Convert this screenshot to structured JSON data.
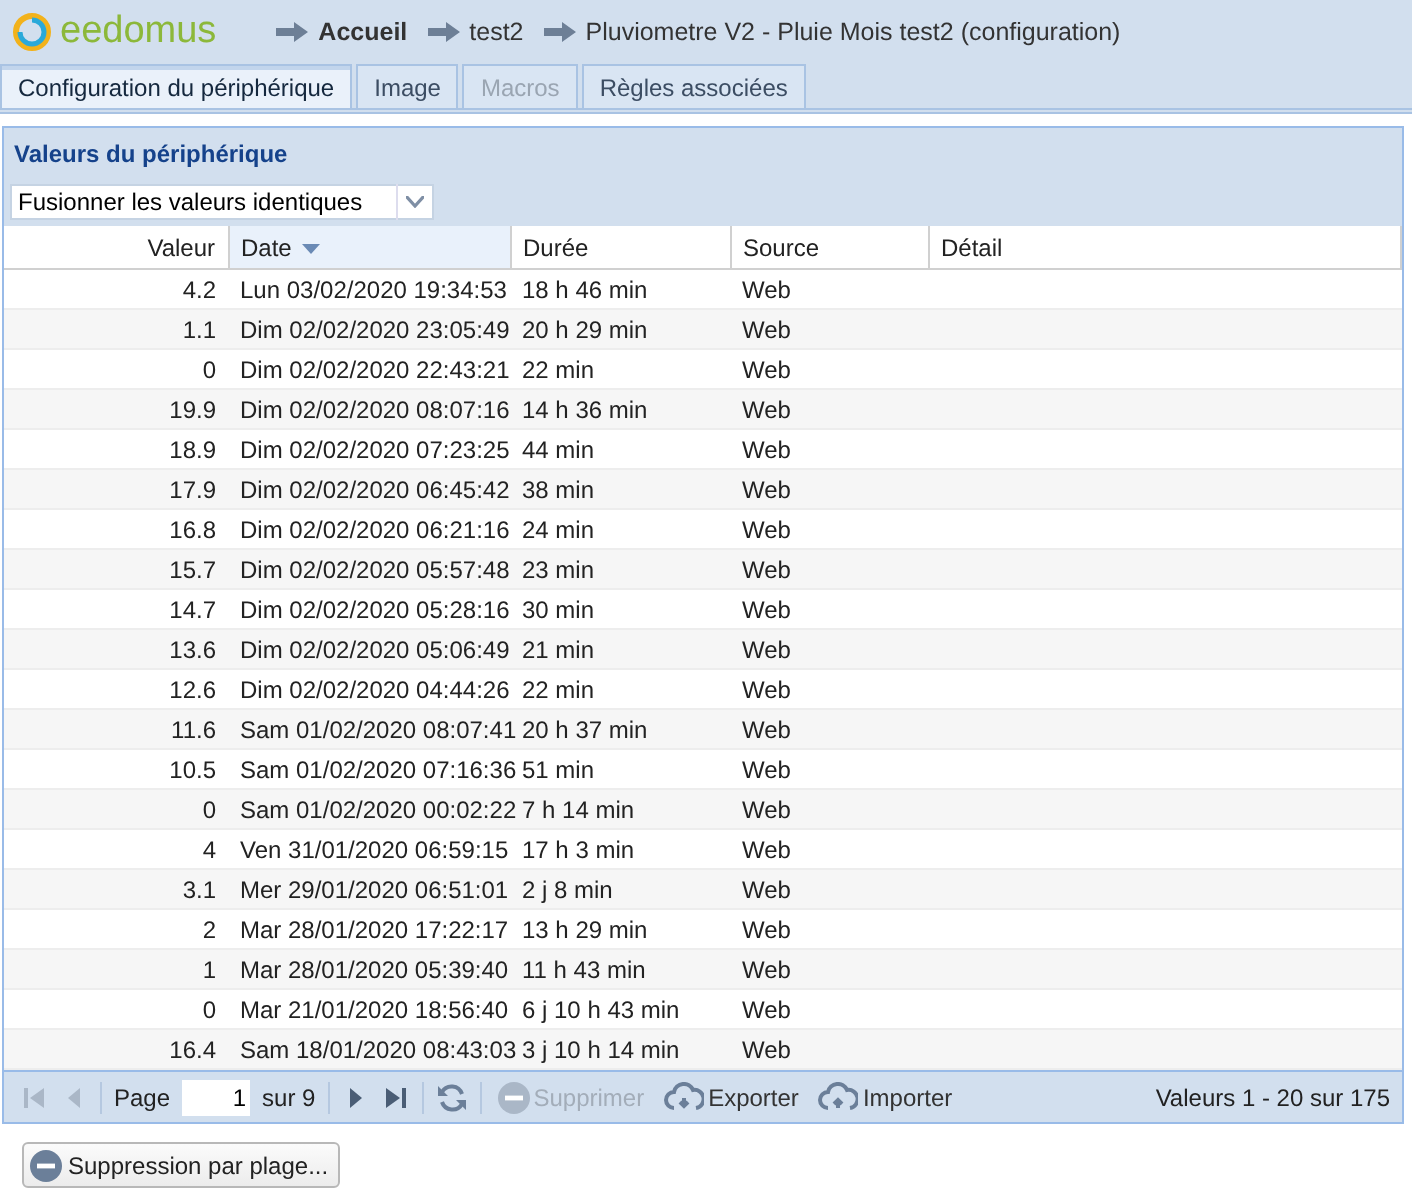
{
  "logo": {
    "text": "eedomus"
  },
  "breadcrumb": [
    {
      "label": "Accueil",
      "bold": true
    },
    {
      "label": "test2",
      "bold": false
    },
    {
      "label": "Pluviometre V2 - Pluie Mois test2 (configuration)",
      "bold": false
    }
  ],
  "tabs": [
    {
      "label": "Configuration du périphérique",
      "selected": true,
      "disabled": false
    },
    {
      "label": "Image",
      "selected": false,
      "disabled": false
    },
    {
      "label": "Macros",
      "selected": false,
      "disabled": true
    },
    {
      "label": "Règles associées",
      "selected": false,
      "disabled": false
    }
  ],
  "panel": {
    "title": "Valeurs du périphérique",
    "filter": {
      "value": "Fusionner les valeurs identiques"
    }
  },
  "table": {
    "columns": [
      {
        "label": "Valeur",
        "sorted": false
      },
      {
        "label": "Date",
        "sorted": true
      },
      {
        "label": "Durée",
        "sorted": false
      },
      {
        "label": "Source",
        "sorted": false
      },
      {
        "label": "Détail",
        "sorted": false
      }
    ],
    "rows": [
      [
        "4.2",
        "Lun 03/02/2020 19:34:53",
        "18 h 46 min",
        "Web"
      ],
      [
        "1.1",
        "Dim 02/02/2020 23:05:49",
        "20 h 29 min",
        "Web"
      ],
      [
        "0",
        "Dim 02/02/2020 22:43:21",
        "22 min",
        "Web"
      ],
      [
        "19.9",
        "Dim 02/02/2020 08:07:16",
        "14 h 36 min",
        "Web"
      ],
      [
        "18.9",
        "Dim 02/02/2020 07:23:25",
        "44 min",
        "Web"
      ],
      [
        "17.9",
        "Dim 02/02/2020 06:45:42",
        "38 min",
        "Web"
      ],
      [
        "16.8",
        "Dim 02/02/2020 06:21:16",
        "24 min",
        "Web"
      ],
      [
        "15.7",
        "Dim 02/02/2020 05:57:48",
        "23 min",
        "Web"
      ],
      [
        "14.7",
        "Dim 02/02/2020 05:28:16",
        "30 min",
        "Web"
      ],
      [
        "13.6",
        "Dim 02/02/2020 05:06:49",
        "21 min",
        "Web"
      ],
      [
        "12.6",
        "Dim 02/02/2020 04:44:26",
        "22 min",
        "Web"
      ],
      [
        "11.6",
        "Sam 01/02/2020 08:07:41",
        "20 h 37 min",
        "Web"
      ],
      [
        "10.5",
        "Sam 01/02/2020 07:16:36",
        "51 min",
        "Web"
      ],
      [
        "0",
        "Sam 01/02/2020 00:02:22",
        "7 h 14 min",
        "Web"
      ],
      [
        "4",
        "Ven 31/01/2020 06:59:15",
        "17 h 3 min",
        "Web"
      ],
      [
        "3.1",
        "Mer 29/01/2020 06:51:01",
        "2 j 8 min",
        "Web"
      ],
      [
        "2",
        "Mar 28/01/2020 17:22:17",
        "13 h 29 min",
        "Web"
      ],
      [
        "1",
        "Mar 28/01/2020 05:39:40",
        "11 h 43 min",
        "Web"
      ],
      [
        "0",
        "Mar 21/01/2020 18:56:40",
        "6 j 10 h 43 min",
        "Web"
      ],
      [
        "16.4",
        "Sam 18/01/2020 08:43:03",
        "3 j 10 h 14 min",
        "Web"
      ]
    ]
  },
  "pager": {
    "page_label": "Page",
    "page": "1",
    "of": "sur 9",
    "nav": [
      {
        "kind": "first",
        "disabled": true
      },
      {
        "kind": "prev",
        "disabled": true
      },
      {
        "kind": "next",
        "disabled": false
      },
      {
        "kind": "last",
        "disabled": false
      }
    ],
    "actions": [
      {
        "kind": "delete",
        "label": "Supprimer",
        "disabled": true
      },
      {
        "kind": "export",
        "label": "Exporter",
        "disabled": false
      },
      {
        "kind": "import",
        "label": "Importer",
        "disabled": false
      }
    ],
    "summary": "Valeurs 1 - 20 sur 175"
  },
  "range_button": {
    "label": "Suppression par plage..."
  }
}
